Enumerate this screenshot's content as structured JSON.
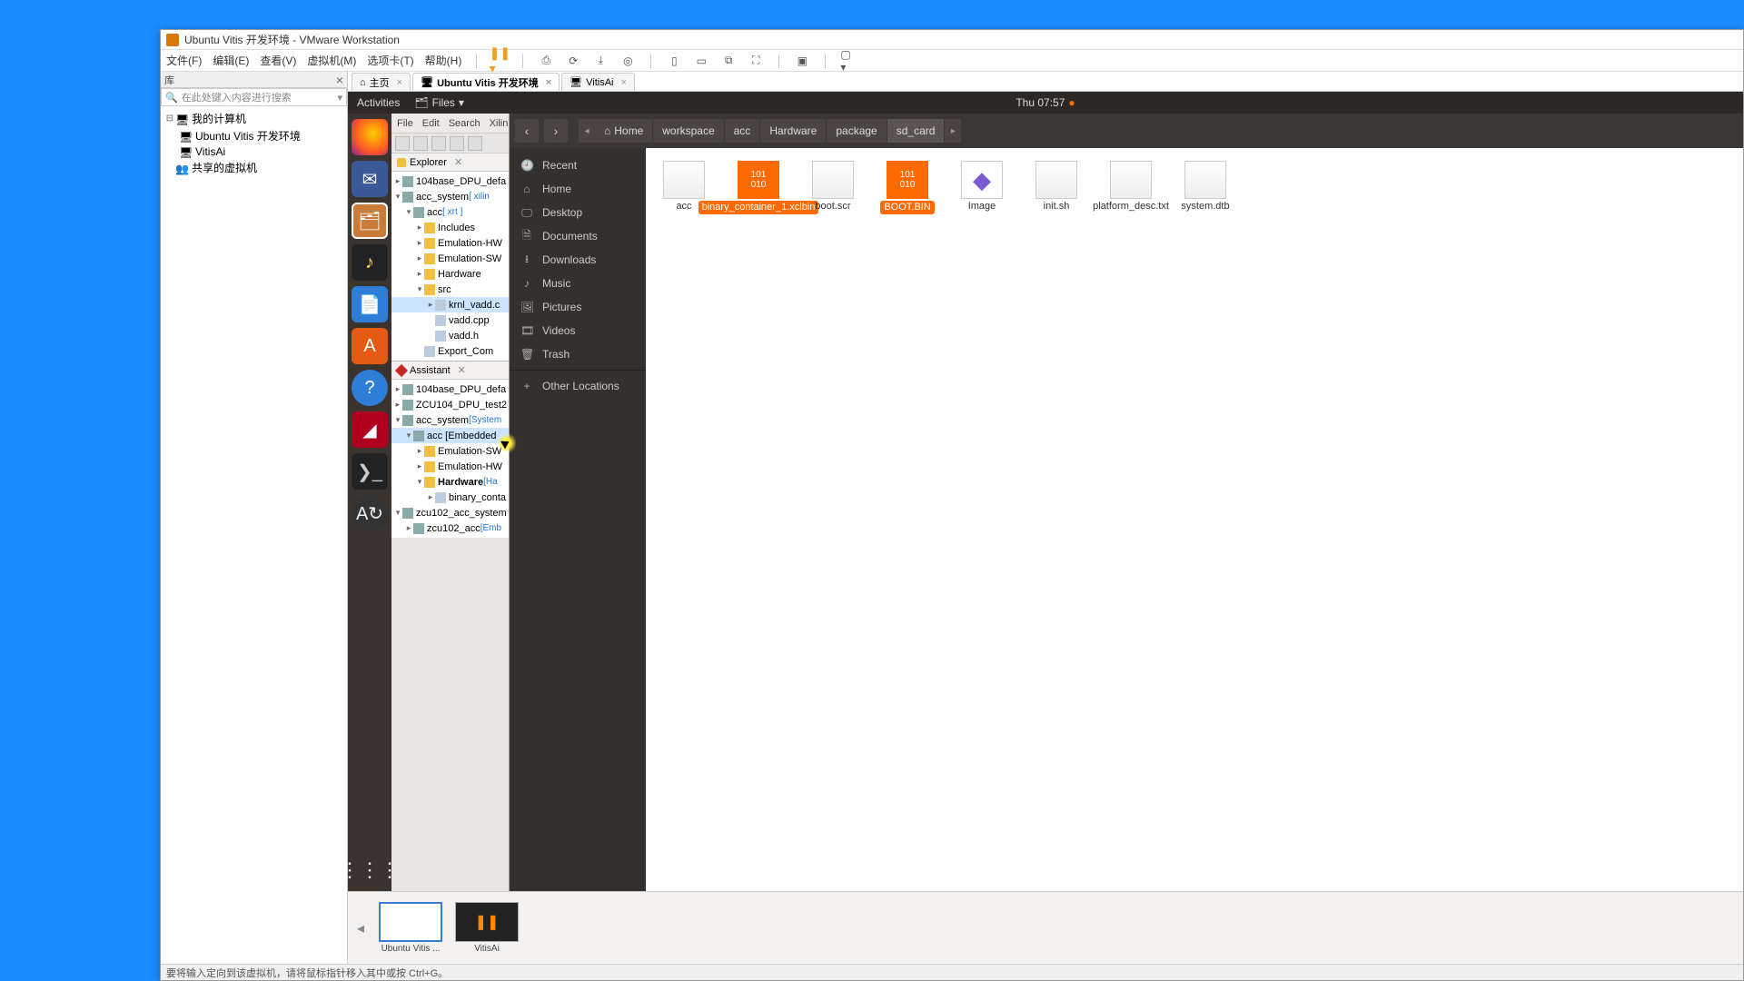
{
  "window": {
    "title": "Ubuntu Vitis 开发环境 - VMware Workstation"
  },
  "menubar": {
    "file": "文件(F)",
    "edit": "编辑(E)",
    "view": "查看(V)",
    "vm": "虚拟机(M)",
    "tabs": "选项卡(T)",
    "help": "帮助(H)"
  },
  "library": {
    "title": "库",
    "search_placeholder": "在此处键入内容进行搜索",
    "root": "我的计算机",
    "vm1": "Ubuntu Vitis 开发环境",
    "vm2": "VitisAi",
    "shared": "共享的虚拟机"
  },
  "vmtabs": {
    "home": "主页",
    "t1": "Ubuntu Vitis 开发环境",
    "t2": "VitisAi"
  },
  "gnome": {
    "activities": "Activities",
    "files": "Files",
    "clock": "Thu 07:57"
  },
  "vitis": {
    "menu": {
      "file": "File",
      "edit": "Edit",
      "search": "Search",
      "xilinx": "Xilin"
    },
    "explorer_tab": "Explorer",
    "assistant_tab": "Assistant",
    "tree": {
      "n0": "104base_DPU_defa",
      "n1": "acc_system",
      "n1x": "[ xilin",
      "n2": "acc",
      "n2x": "[ xrt ]",
      "n3": "Includes",
      "n4": "Emulation-HW",
      "n5": "Emulation-SW",
      "n6": "Hardware",
      "n7": "src",
      "n8": "krnl_vadd.c",
      "n9": "vadd.cpp",
      "n10": "vadd.h",
      "n11": "Export_Com"
    },
    "asst": {
      "a0": "104base_DPU_defa",
      "a1": "ZCU104_DPU_test2",
      "a2": "acc_system",
      "a2x": "[System",
      "a3": "acc [Embedded",
      "a4": "Emulation-SW",
      "a5": "Emulation-HW",
      "a6": "Hardware",
      "a6x": "[Ha",
      "a7": "binary_conta",
      "a8": "zcu102_acc_system",
      "a9": "zcu102_acc",
      "a9x": "[Emb"
    }
  },
  "nautilus": {
    "path": [
      "Home",
      "workspace",
      "acc",
      "Hardware",
      "package",
      "sd_card"
    ],
    "sidebar": {
      "recent": "Recent",
      "home": "Home",
      "desktop": "Desktop",
      "documents": "Documents",
      "downloads": "Downloads",
      "music": "Music",
      "pictures": "Pictures",
      "videos": "Videos",
      "trash": "Trash",
      "other": "Other Locations"
    },
    "files": {
      "acc": "acc",
      "binary": "binary_container_1.xclbin",
      "bootscr": "boot.scr",
      "bootbin": "BOOT.BIN",
      "image": "Image",
      "init": "init.sh",
      "platform": "platform_desc.txt",
      "systemdtb": "system.dtb"
    }
  },
  "thumbs": {
    "t1": "Ubuntu Vitis ...",
    "t2": "VitisAi"
  },
  "status": "要将输入定向到该虚拟机，请将鼠标指针移入其中或按 Ctrl+G。"
}
